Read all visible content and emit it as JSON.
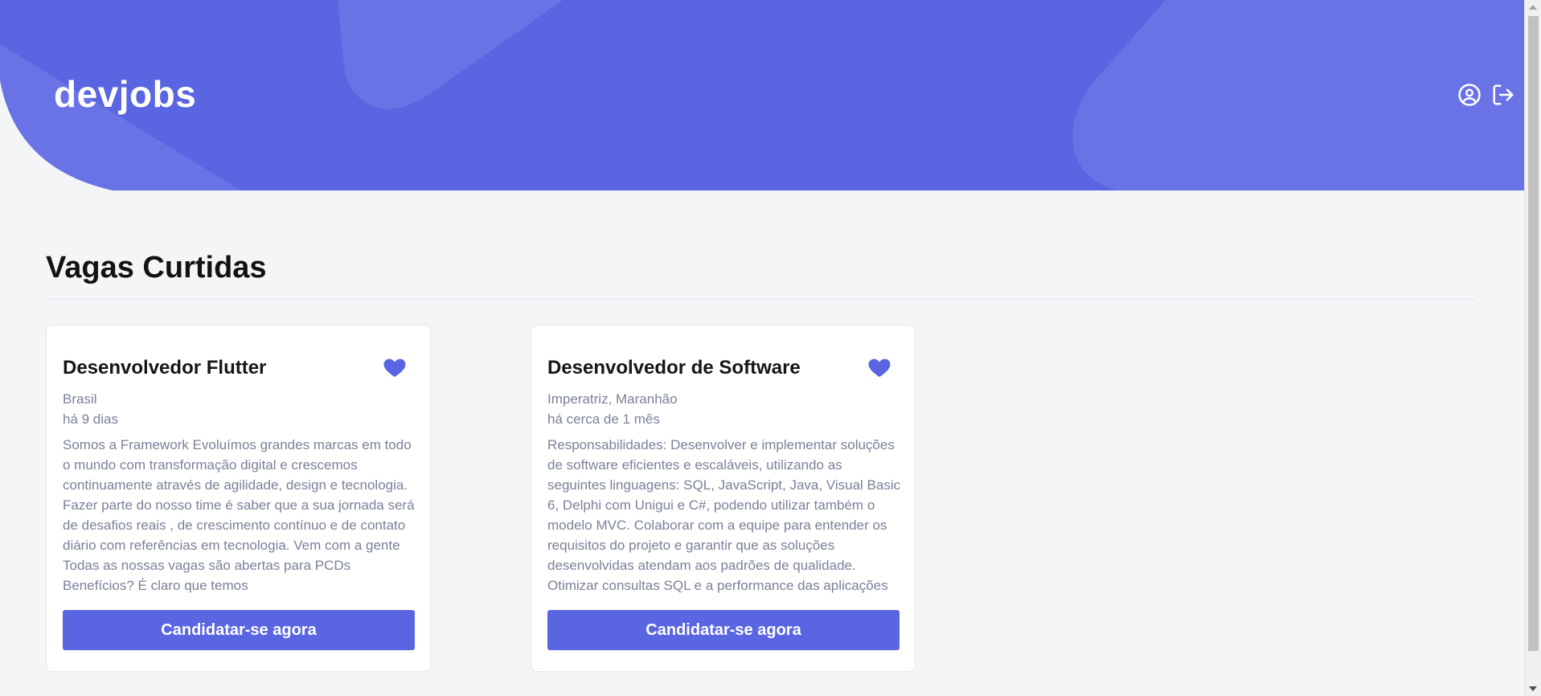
{
  "header": {
    "brand": "devjobs",
    "profile_icon": "user-circle-icon",
    "logout_icon": "logout-icon"
  },
  "main": {
    "section_title": "Vagas Curtidas",
    "jobs": [
      {
        "title": "Desenvolvedor Flutter",
        "location": "Brasil",
        "posted": "há 9 dias",
        "description": "Somos a Framework Evoluímos grandes marcas em todo o mundo com transformação digital e crescemos continuamente através de agilidade, design e tecnologia. Fazer parte do nosso time é saber que a sua jornada será de desafios reais , de crescimento contínuo e de contato diário com referências em tecnologia. Vem com a gente Todas as nossas vagas são abertas para PCDs Benefícios? É claro que temos",
        "apply_label": "Candidatar-se agora",
        "favorite_icon": "heart-icon"
      },
      {
        "title": "Desenvolvedor de Software",
        "location": "Imperatriz, Maranhão",
        "posted": "há cerca de 1 mês",
        "description": "Responsabilidades: Desenvolver e implementar soluções de software eficientes e escaláveis, utilizando as seguintes linguagens: SQL, JavaScript, Java, Visual Basic 6, Delphi com Unigui e C#, podendo utilizar também o modelo MVC. Colaborar com a equipe para entender os requisitos do projeto e garantir que as soluções desenvolvidas atendam aos padrões de qualidade. Otimizar consultas SQL e a performance das aplicações",
        "apply_label": "Candidatar-se agora",
        "favorite_icon": "heart-icon"
      }
    ]
  },
  "colors": {
    "accent": "#5a65e1",
    "background": "#f4f5f7",
    "muted_text": "#7a8199"
  }
}
